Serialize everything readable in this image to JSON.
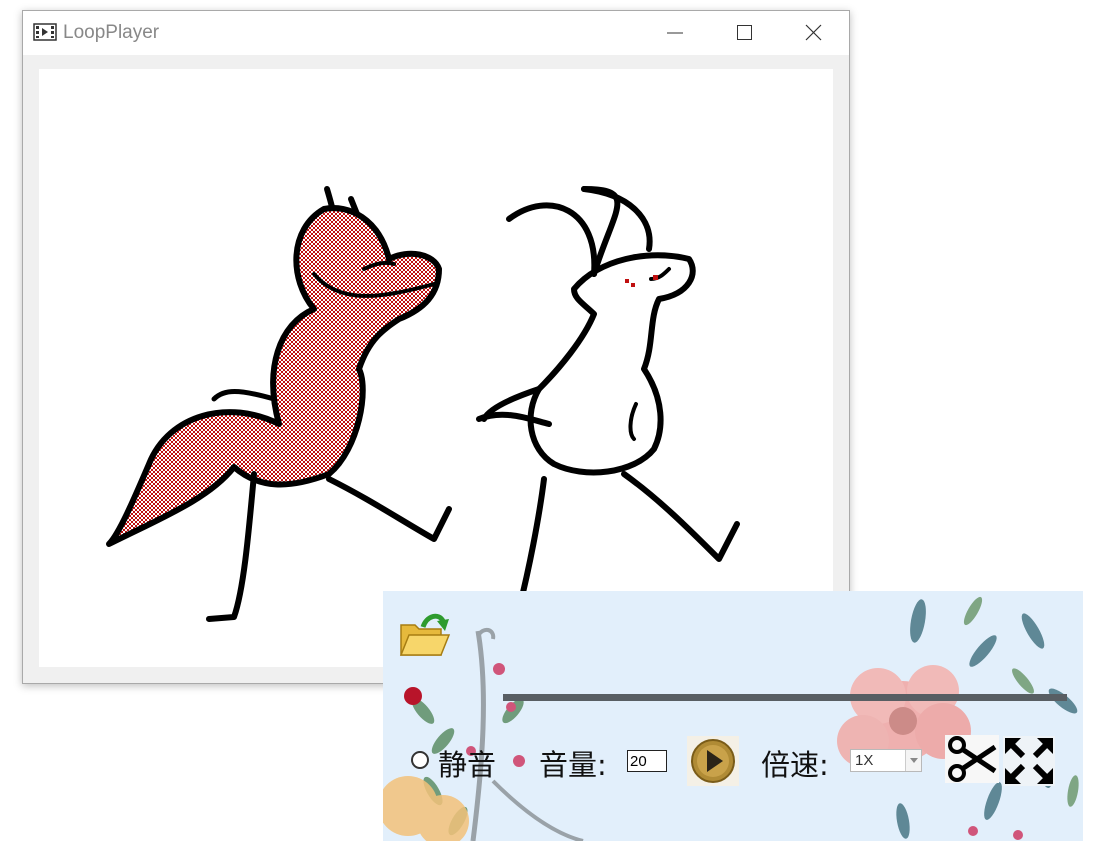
{
  "window": {
    "title": "LoopPlayer",
    "icon": "film-icon",
    "controls": [
      "minimize-icon",
      "maximize-icon",
      "close-icon"
    ]
  },
  "video": {
    "scene": "animation-frame",
    "accent_red": "#c01010"
  },
  "controls": {
    "open_icon": "folder-open-icon",
    "progress_fraction": 1.0,
    "mute_label": "静音",
    "mute_checked": false,
    "volume_label": "音量:",
    "volume_value": "20",
    "play_icon": "play-icon",
    "speed_label": "倍速:",
    "speed_value": "1X",
    "cut_icon": "scissors-icon",
    "fullscreen_icon": "fullscreen-icon",
    "panel_bg": "#e2effb",
    "track_color": "#585e63"
  }
}
